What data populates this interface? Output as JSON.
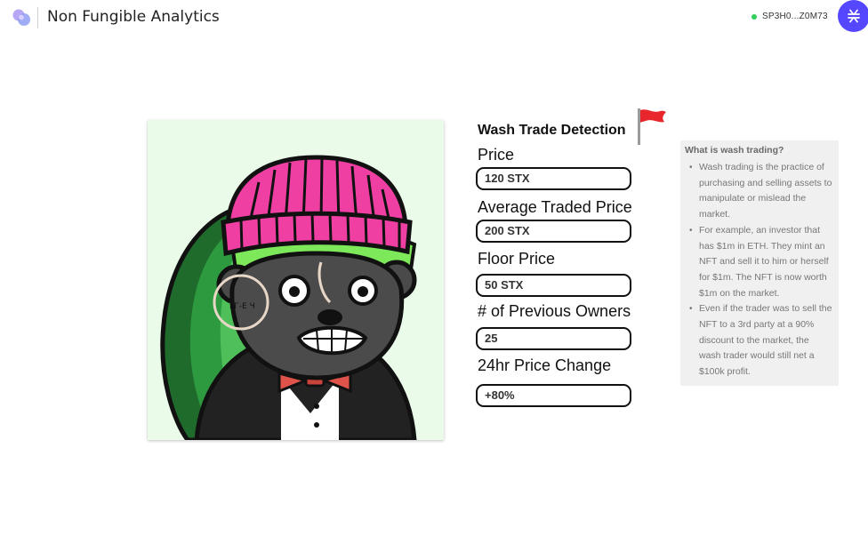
{
  "header": {
    "app_title": "Non Fungible Analytics",
    "wallet_address": "SP3H0...Z0M73",
    "wallet_status_color": "#2fcf58",
    "stacks_button_color": "#5546ff",
    "stacks_icon": "stacks-logo-icon"
  },
  "detection": {
    "title": "Wash Trade Detection",
    "flag_icon": "red-flag-icon",
    "fields": [
      {
        "label": "Price",
        "value": "120 STX"
      },
      {
        "label": "Average Traded Price",
        "value": "200 STX"
      },
      {
        "label": "Floor Price",
        "value": "50 STX"
      },
      {
        "label": "# of Previous Owners",
        "value": "25"
      },
      {
        "label": "24hr Price Change",
        "value": "+80%"
      }
    ]
  },
  "info": {
    "title": "What is wash trading?",
    "items": [
      "Wash trading is the practice of purchasing and selling assets to manipulate or mislead the market.",
      "For example, an investor that has $1m in ETH. They mint an NFT and sell it to him or herself for $1m. The NFT is now worth $1m on the market.",
      "Even if the trader was to sell the NFT to a 3rd party at a 90% discount to the market, the wash trader would still net a $100k profit."
    ]
  },
  "nft": {
    "image": "nft-character-image",
    "background_color": "#eafbea",
    "tattoo_text": "ьГ-Е Ч"
  }
}
